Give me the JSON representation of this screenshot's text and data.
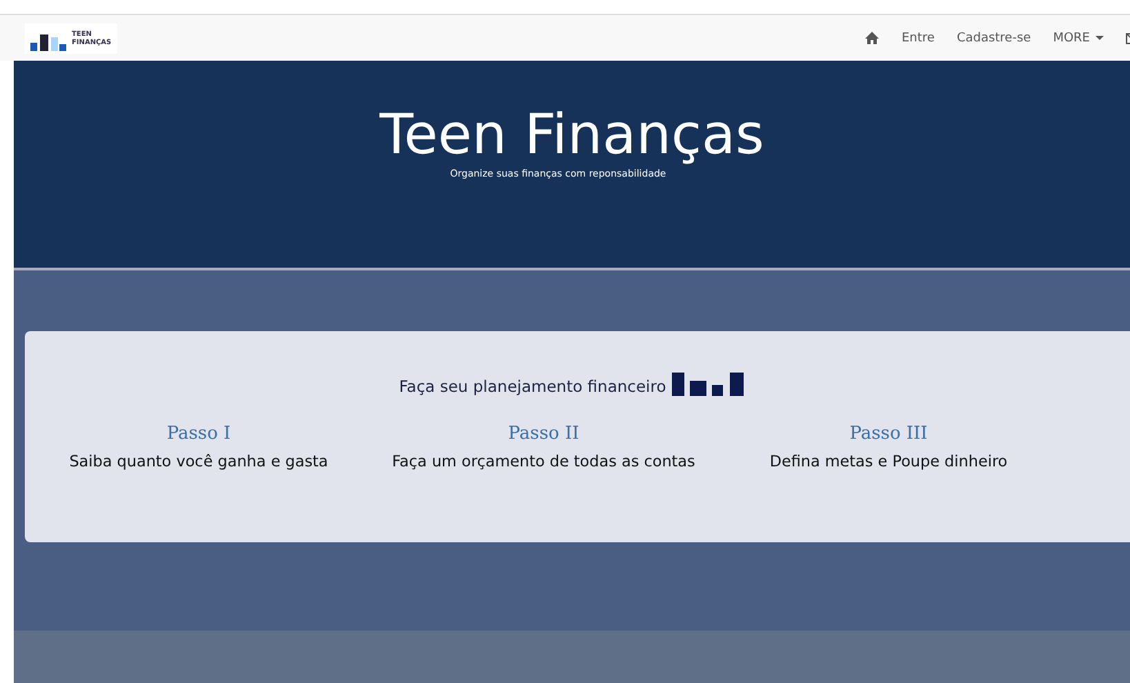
{
  "navbar": {
    "logo": {
      "line_1": "TEEN",
      "line_2": "FINANÇAS"
    },
    "links": [
      {
        "kind": "home"
      },
      {
        "kind": "text",
        "label": "Entre"
      },
      {
        "kind": "text",
        "label": "Cadastre-se"
      },
      {
        "kind": "dropdown",
        "label": "MORE"
      },
      {
        "kind": "mail"
      }
    ]
  },
  "hero": {
    "title": "Teen Finanças",
    "subtitle": "Organize suas finanças com reponsabilidade"
  },
  "card": {
    "heading": "Faça seu planejamento financeiro",
    "steps": [
      {
        "title": "Passo I",
        "text": "Saiba quanto você ganha e gasta"
      },
      {
        "title": "Passo II",
        "text": "Faça um orçamento de todas as contas"
      },
      {
        "title": "Passo III",
        "text": "Defina metas e Poupe dinheiro"
      }
    ]
  }
}
